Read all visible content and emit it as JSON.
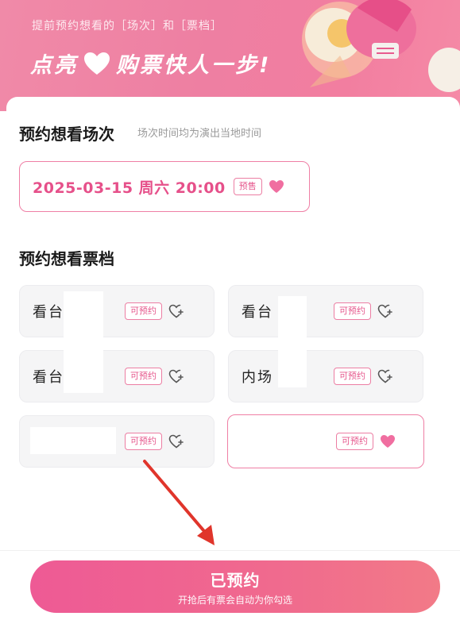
{
  "banner": {
    "subtitle": "提前预约想看的［场次］和［票档］",
    "headline_left": "点亮",
    "headline_right": "购票快人一步!"
  },
  "session_section": {
    "title": "预约想看场次",
    "note": "场次时间均为演出当地时间",
    "session": {
      "datetime": "2025-03-15 周六 20:00",
      "tag": "预售",
      "liked": true
    }
  },
  "ticket_section": {
    "title": "预约想看票档",
    "tickets": [
      {
        "label": "看台 元",
        "tag": "可预约",
        "liked": false,
        "selected": false
      },
      {
        "label": "看台 元",
        "tag": "可预约",
        "liked": false,
        "selected": false
      },
      {
        "label": "看台 元",
        "tag": "可预约",
        "liked": false,
        "selected": false
      },
      {
        "label": "内场 元",
        "tag": "可预约",
        "liked": false,
        "selected": false
      },
      {
        "label": "",
        "tag": "可预约",
        "liked": false,
        "selected": false
      },
      {
        "label": "",
        "tag": "可预约",
        "liked": true,
        "selected": true
      }
    ]
  },
  "cta": {
    "main_label": "已预约",
    "sub_label": "开抢后有票会自动为你勾选"
  },
  "icons": {
    "heart_filled": "heart-filled-icon",
    "heart_add": "heart-plus-icon",
    "arrow": "red-arrow-annotation"
  },
  "colors": {
    "accent": "#e6508a",
    "banner": "#ef7fa2",
    "annotation_arrow": "#e0352b"
  }
}
